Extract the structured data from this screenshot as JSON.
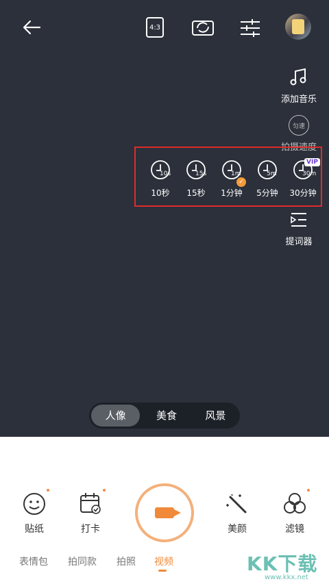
{
  "topbar": {
    "ratio_label": "4:3"
  },
  "side_tools": {
    "music_label": "添加音乐",
    "speed_badge": "匀速",
    "speed_label": "拍摄速度",
    "prompter_label": "提词器"
  },
  "durations": [
    {
      "tag": "10s",
      "label": "10秒"
    },
    {
      "tag": "15s",
      "label": "15秒"
    },
    {
      "tag": "1m",
      "label": "1分钟",
      "selected": true
    },
    {
      "tag": "5m",
      "label": "5分钟"
    },
    {
      "tag": "30m",
      "label": "30分钟",
      "badge": "VIP"
    }
  ],
  "modes": [
    {
      "label": "人像",
      "active": true
    },
    {
      "label": "美食"
    },
    {
      "label": "风景"
    }
  ],
  "tools": {
    "sticker": "贴纸",
    "checkin": "打卡",
    "beauty": "美颜",
    "filter": "滤镜"
  },
  "tabs": [
    "表情包",
    "拍同款",
    "拍照",
    "视频"
  ],
  "active_tab": "视频",
  "watermark": {
    "main": "KK下载",
    "sub": "www.kkx.net"
  },
  "colors": {
    "viewfinder_bg": "#2b303a",
    "accent": "#f08a3a",
    "highlight_box": "#e02b2b"
  }
}
